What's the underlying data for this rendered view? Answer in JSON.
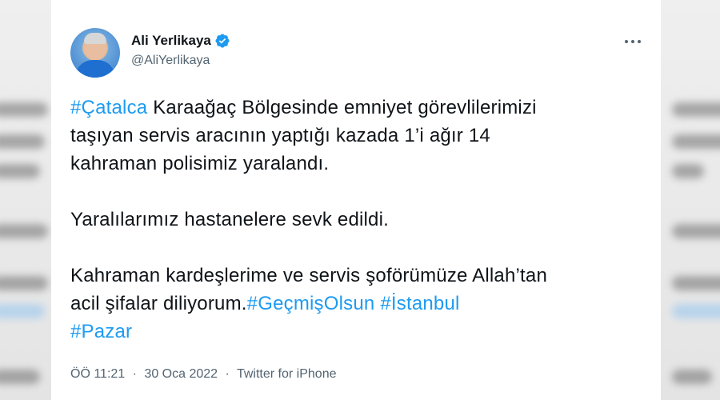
{
  "tweet": {
    "display_name": "Ali Yerlikaya",
    "handle": "@AliYerlikaya",
    "paragraphs": [
      [
        {
          "text": "#Çatalca",
          "hashtag": true
        },
        {
          "text": " Karaağaç Bölgesinde emniyet görevlilerimizi",
          "hashtag": false
        },
        {
          "br": true
        },
        {
          "text": "taşıyan servis aracının yaptığı kazada 1’i ağır 14",
          "hashtag": false
        },
        {
          "br": true
        },
        {
          "text": "kahraman polisimiz yaralandı.",
          "hashtag": false
        }
      ],
      [
        {
          "text": "Yaralılarımız hastanelere sevk edildi.",
          "hashtag": false
        }
      ],
      [
        {
          "text": "Kahraman kardeşlerime ve servis şoförümüze Allah’tan",
          "hashtag": false
        },
        {
          "br": true
        },
        {
          "text": "acil şifalar diliyorum.",
          "hashtag": false
        },
        {
          "text": "#GeçmişOlsun",
          "hashtag": true
        },
        {
          "text": " ",
          "hashtag": false
        },
        {
          "text": "#İstanbul",
          "hashtag": true
        },
        {
          "br": true
        },
        {
          "text": "#Pazar",
          "hashtag": true
        }
      ]
    ],
    "time": "ÖÖ 11:21",
    "date": "30 Oca 2022",
    "separator": "·",
    "source": "Twitter for iPhone"
  },
  "icons": {
    "verified": "verified-badge-icon",
    "more": "more-options-icon",
    "avatar": "profile-avatar"
  },
  "colors": {
    "hashtag": "#1d9bf0",
    "verified": "#1d9bf0",
    "text": "#0f1419",
    "muted": "#536471"
  }
}
